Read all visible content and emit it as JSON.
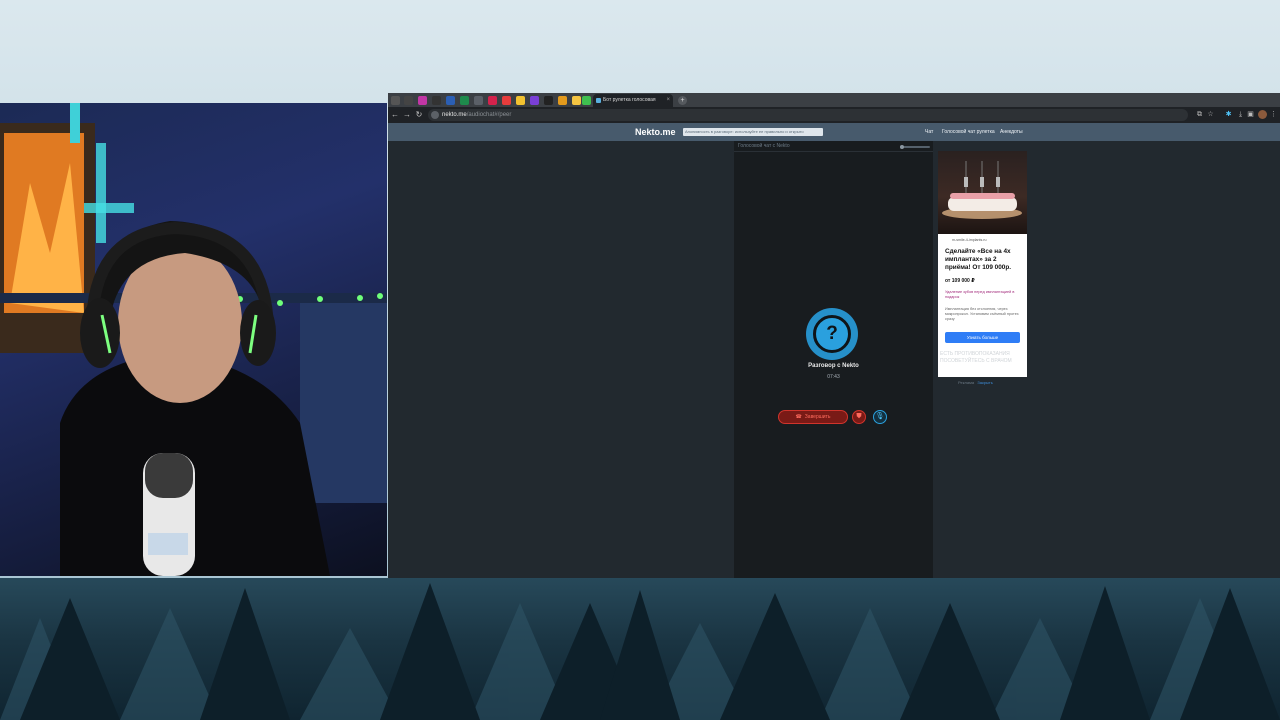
{
  "browser": {
    "tab_title": "Бот рулетка голосовая",
    "new_tab": "+",
    "url_host": "nekto.me",
    "url_path": "/audiochat#/peer",
    "nav": {
      "back": "←",
      "forward": "→",
      "reload": "↻"
    }
  },
  "site": {
    "logo": "Nekto.me",
    "notice": "Анонимность в разговоре: используйте ее правильно и открыто",
    "nav": [
      "Чат",
      "Голосовой чат рулетка",
      "Анекдоты"
    ],
    "chat_header": "Голосовой чат с Nekto",
    "avatar_symbol": "?",
    "peer_label": "Разговор с Nekto",
    "timer": "07:43",
    "end_button": "Завершить",
    "colors": {
      "accent": "#2aa0de",
      "danger": "#d0342c",
      "header": "#475a6c",
      "cta": "#2f7df6"
    }
  },
  "ad": {
    "domain": "m-smile-4-implants.ru",
    "title": "Сделайте «Все на 4х имплантах» за 2 приёма! От 109 000р.",
    "price": "от 109 000 ₽",
    "promo": "Удаление зубов перед имплантацией в подарок",
    "description": "Имплантация без отслоения, через микропрокол. Установим съёмный протез сразу",
    "cta": "Узнать больше",
    "faded": "ЕСТЬ ПРОТИВОПОКАЗАНИЯ ПОСОВЕТУЙТЕСЬ С ВРАЧОМ",
    "footer_a": "Реклама",
    "footer_b": "Закрыть"
  }
}
